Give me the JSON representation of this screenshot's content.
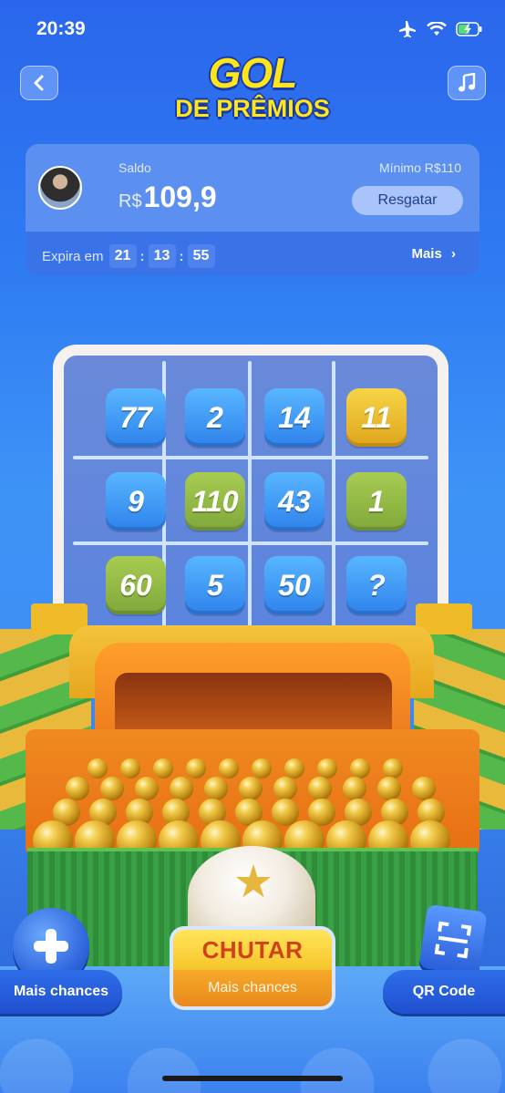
{
  "status_bar": {
    "time": "20:39"
  },
  "header": {
    "logo_line1": "GOL",
    "logo_line2": "DE PRÊMIOS"
  },
  "balance": {
    "label": "Saldo",
    "currency": "R$",
    "amount": "109,9",
    "minimum": "Mínimo  R$110",
    "redeem_button": "Resgatar",
    "expires_label": "Expira em",
    "expires_hours": "21",
    "expires_minutes": "13",
    "expires_seconds": "55",
    "more_link": "Mais"
  },
  "grid": {
    "cells": [
      {
        "value": "77",
        "color": "blue"
      },
      {
        "value": "2",
        "color": "blue"
      },
      {
        "value": "14",
        "color": "blue"
      },
      {
        "value": "11",
        "color": "gold"
      },
      {
        "value": "9",
        "color": "blue"
      },
      {
        "value": "110",
        "color": "green"
      },
      {
        "value": "43",
        "color": "blue"
      },
      {
        "value": "1",
        "color": "green"
      },
      {
        "value": "60",
        "color": "green"
      },
      {
        "value": "5",
        "color": "blue"
      },
      {
        "value": "50",
        "color": "blue"
      },
      {
        "value": "?",
        "color": "blue"
      }
    ]
  },
  "actions": {
    "more_chances_label": "Mais chances",
    "kick_label": "CHUTAR",
    "kick_sub_label": "Mais chances",
    "qr_label": "QR Code"
  },
  "colors": {
    "brand_yellow": "#ffe61a",
    "background_blue": "#2f7cf2",
    "kick_text": "#d0421a"
  }
}
